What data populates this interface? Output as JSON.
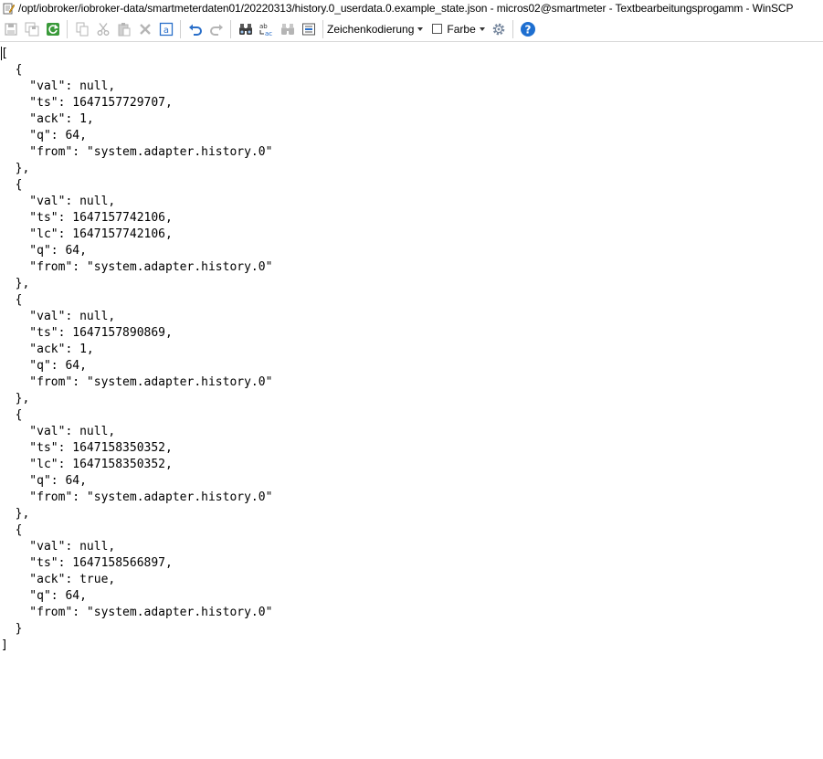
{
  "window": {
    "title": "/opt/iobroker/iobroker-data/smartmeterdaten01/20220313/history.0_userdata.0.example_state.json - micros02@smartmeter - Textbearbeitungsprogamm - WinSCP"
  },
  "toolbar": {
    "encoding_label": "Zeichenkodierung",
    "color_label": "Farbe",
    "color_checked": false,
    "icons": [
      "save-icon",
      "save-all-icon",
      "reload-icon",
      "copy-icon",
      "cut-icon",
      "paste-icon",
      "delete-icon",
      "select-all-icon",
      "undo-icon",
      "redo-icon",
      "find-icon",
      "replace-icon",
      "find-next-icon",
      "goto-line-icon",
      "settings-icon",
      "help-icon"
    ]
  },
  "editor": {
    "lines": [
      "[",
      "  {",
      "    \"val\": null,",
      "    \"ts\": 1647157729707,",
      "    \"ack\": 1,",
      "    \"q\": 64,",
      "    \"from\": \"system.adapter.history.0\"",
      "  },",
      "  {",
      "    \"val\": null,",
      "    \"ts\": 1647157742106,",
      "    \"lc\": 1647157742106,",
      "    \"q\": 64,",
      "    \"from\": \"system.adapter.history.0\"",
      "  },",
      "  {",
      "    \"val\": null,",
      "    \"ts\": 1647157890869,",
      "    \"ack\": 1,",
      "    \"q\": 64,",
      "    \"from\": \"system.adapter.history.0\"",
      "  },",
      "  {",
      "    \"val\": null,",
      "    \"ts\": 1647158350352,",
      "    \"lc\": 1647158350352,",
      "    \"q\": 64,",
      "    \"from\": \"system.adapter.history.0\"",
      "  },",
      "  {",
      "    \"val\": null,",
      "    \"ts\": 1647158566897,",
      "    \"ack\": true,",
      "    \"q\": 64,",
      "    \"from\": \"system.adapter.history.0\"",
      "  }",
      "]"
    ]
  },
  "colors": {
    "help_blue": "#1e6fd0",
    "undo_blue": "#2a6fc9",
    "reload_green": "#3a9a3a",
    "disabled_gray": "#b5b5b5"
  }
}
